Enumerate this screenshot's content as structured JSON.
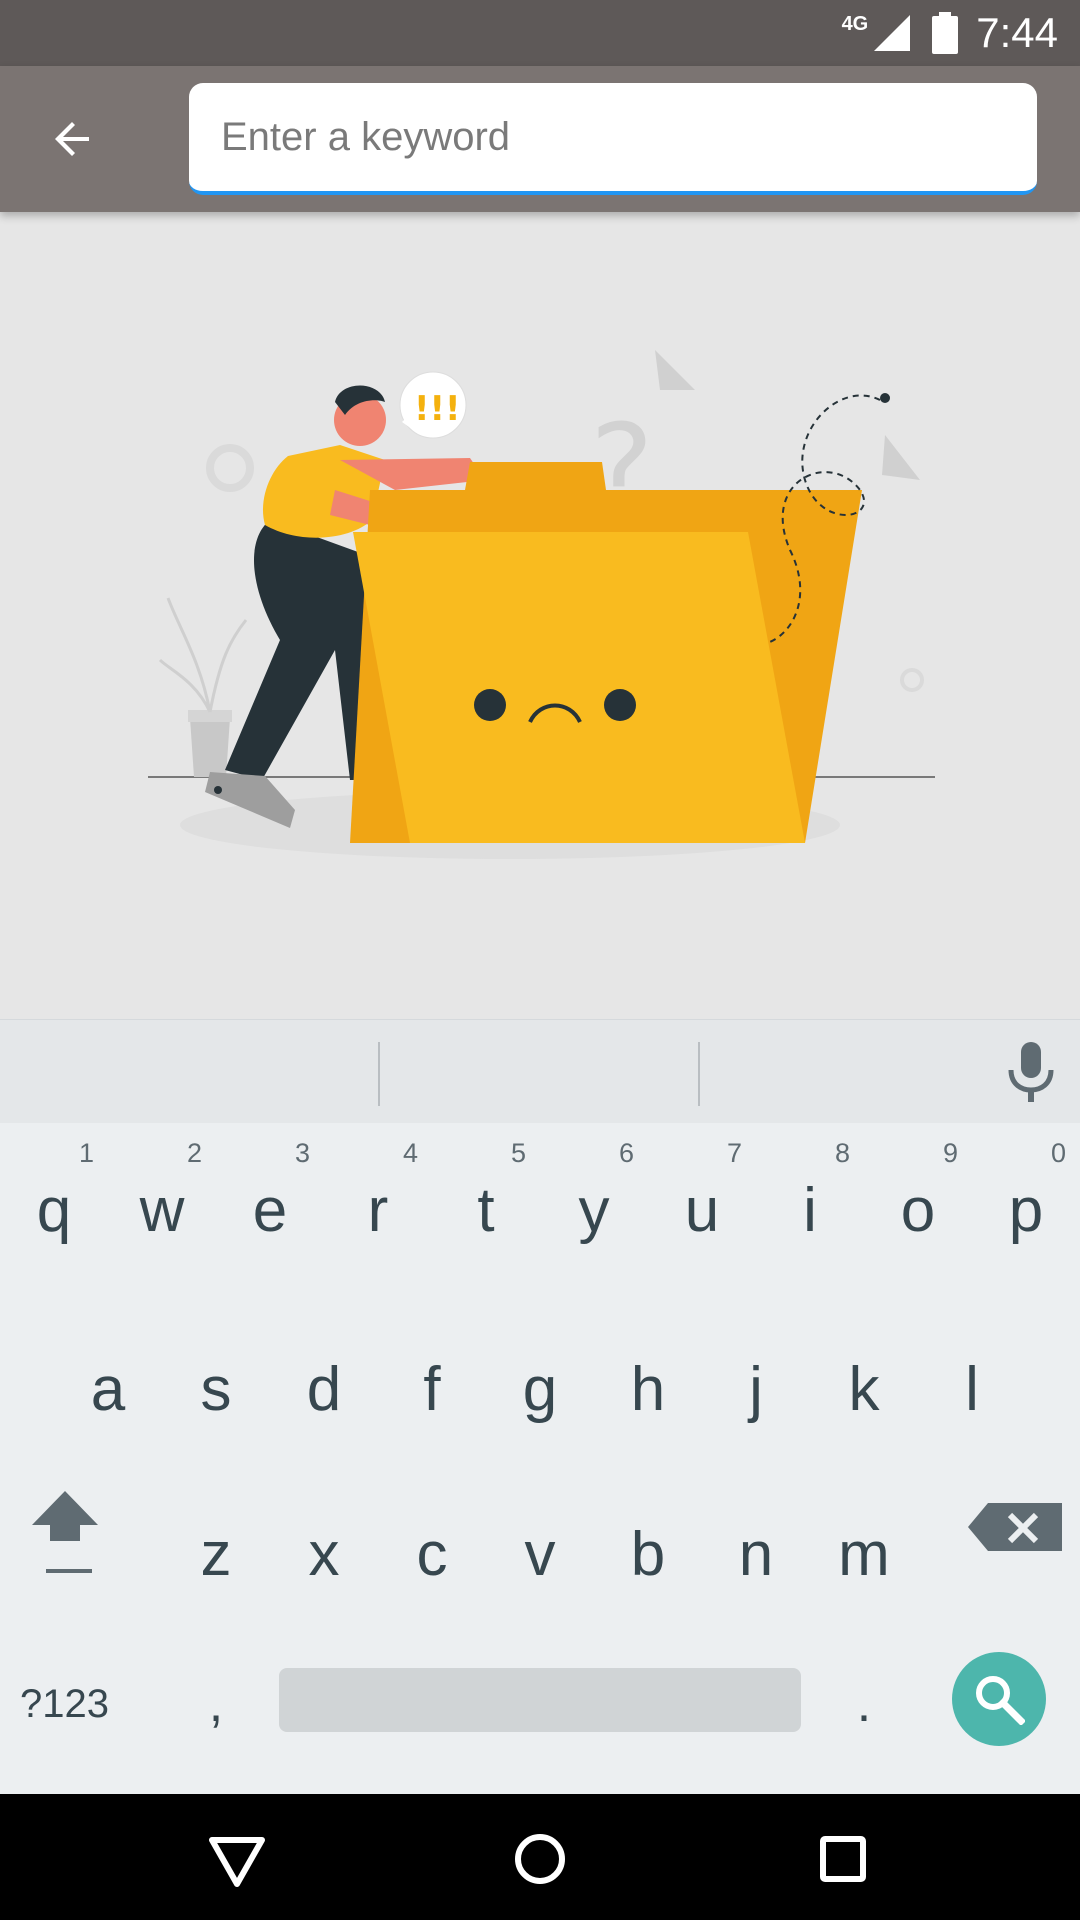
{
  "status_bar": {
    "network": "4G",
    "time": "7:44"
  },
  "search": {
    "placeholder": "Enter a keyword",
    "value": "",
    "underline_color": "#2196f3"
  },
  "illustration": {
    "bubble_text": "!!!",
    "question_mark": "?"
  },
  "keyboard": {
    "row1": [
      {
        "letter": "q",
        "hint": "1"
      },
      {
        "letter": "w",
        "hint": "2"
      },
      {
        "letter": "e",
        "hint": "3"
      },
      {
        "letter": "r",
        "hint": "4"
      },
      {
        "letter": "t",
        "hint": "5"
      },
      {
        "letter": "y",
        "hint": "6"
      },
      {
        "letter": "u",
        "hint": "7"
      },
      {
        "letter": "i",
        "hint": "8"
      },
      {
        "letter": "o",
        "hint": "9"
      },
      {
        "letter": "p",
        "hint": "0"
      }
    ],
    "row2": [
      "a",
      "s",
      "d",
      "f",
      "g",
      "h",
      "j",
      "k",
      "l"
    ],
    "row3": [
      "z",
      "x",
      "c",
      "v",
      "b",
      "n",
      "m"
    ],
    "symbols_label": "?123",
    "comma_label": ",",
    "period_label": ".",
    "search_key_color": "#4db6ac"
  },
  "icons": {
    "back": "arrow-left-icon",
    "mic": "microphone-icon",
    "shift": "shift-icon",
    "backspace": "backspace-icon",
    "search": "search-icon",
    "nav_back": "triangle-back-icon",
    "nav_home": "circle-home-icon",
    "nav_recents": "square-recents-icon"
  }
}
